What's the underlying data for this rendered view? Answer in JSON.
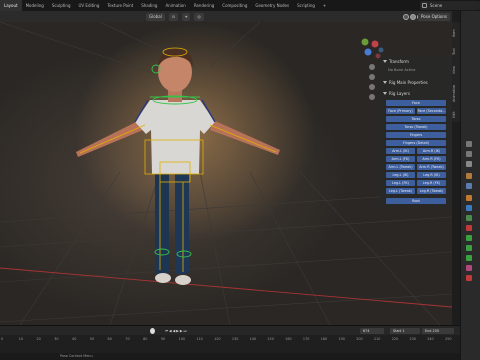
{
  "topbar": {
    "tabs": [
      "Layout",
      "Modeling",
      "Sculpting",
      "UV Editing",
      "Texture Paint",
      "Shading",
      "Animation",
      "Rendering",
      "Compositing",
      "Geometry Nodes",
      "Scripting",
      "+"
    ],
    "active_tab": "Layout",
    "scene": "Scene"
  },
  "viewport_header": {
    "transform_orientation": "Global",
    "pose_options": "Pose Options"
  },
  "npanel": {
    "transform_label": "Transform",
    "transform_note": "No Bone Active",
    "rig_main_label": "Rig Main Properties",
    "rig_layers_label": "Rig Layers",
    "tabs": [
      "Item",
      "Tool",
      "View",
      "Animation",
      "Edit"
    ]
  },
  "rig_layers": {
    "face": "Face",
    "face_primary": "Face (Primary)",
    "face_secondary": "Face (Seconda...",
    "torso": "Torso",
    "torso_tweak": "Torso (Tweak)",
    "fingers": "Fingers",
    "fingers_detail": "Fingers (Detail)",
    "arm_l_ik": "Arm.L (IK)",
    "arm_r_ik": "Arm.R (IK)",
    "arm_l_fk": "Arm.L (FK)",
    "arm_r_fk": "Arm.R (FK)",
    "arm_l_tweak": "Arm.L (Tweak)",
    "arm_r_tweak": "Arm.R (Tweak)",
    "leg_l_ik": "Leg.L (IK)",
    "leg_r_ik": "Leg.R (IK)",
    "leg_l_fk": "Leg.L (FK)",
    "leg_r_fk": "Leg.R (FK)",
    "leg_l_tweak": "Leg.L (Tweak)",
    "leg_r_tweak": "Leg.R (Tweak)",
    "root": "Root"
  },
  "timeline": {
    "current_frame": "674",
    "start_label": "Start",
    "start_value": "1",
    "end_label": "End",
    "end_value": "250",
    "ticks": [
      "0",
      "10",
      "20",
      "30",
      "40",
      "50",
      "60",
      "70",
      "80",
      "90",
      "100",
      "110",
      "120",
      "130",
      "140",
      "150",
      "160",
      "170",
      "180",
      "190",
      "200",
      "210",
      "220",
      "230",
      "240",
      "250"
    ]
  },
  "status_bar": {
    "text": "Pose Context Menu"
  },
  "colors": {
    "accent_blue": "#3e5f9e",
    "axis_red": "#a83434",
    "bone_yellow": "#e0b000",
    "bone_green": "#36c24a"
  }
}
